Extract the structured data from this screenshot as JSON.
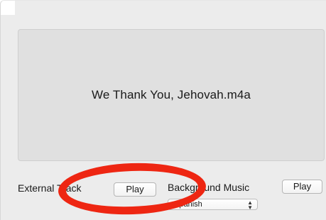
{
  "display": {
    "track_title": "We Thank You, Jehovah.m4a"
  },
  "external_track": {
    "label": "External Track",
    "play_label": "Play"
  },
  "background_music": {
    "label": "Background Music",
    "play_label": "Play",
    "selected_option": "Spanish"
  },
  "annotation": {
    "color": "#ee2612",
    "shape": "ellipse-highlight"
  }
}
